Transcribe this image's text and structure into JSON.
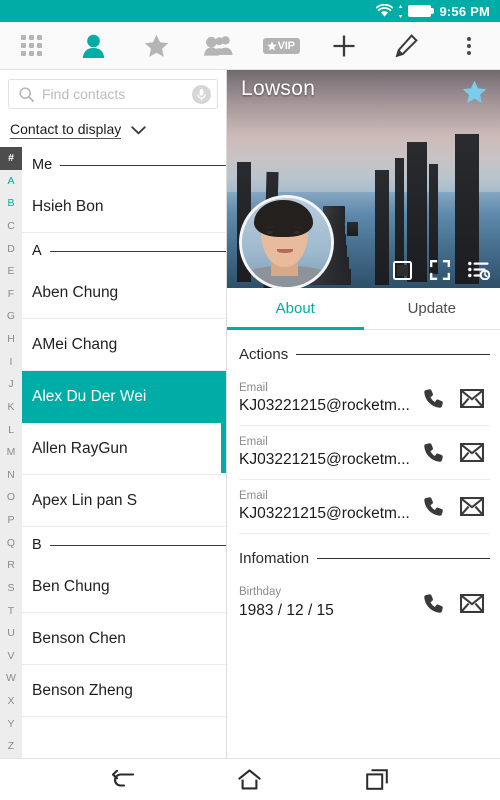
{
  "statusbar": {
    "time": "9:56 PM",
    "wifi_icon": "wifi-icon",
    "battery_icon": "battery-icon",
    "accent": "#00ACA6"
  },
  "toolbar": {
    "items": [
      {
        "name": "groups-grid",
        "icon": "grid-icon",
        "active": false
      },
      {
        "name": "contacts",
        "icon": "person-icon",
        "active": true
      },
      {
        "name": "favorites",
        "icon": "star-icon",
        "active": false
      },
      {
        "name": "groups",
        "icon": "people-group-icon",
        "active": false
      },
      {
        "name": "vip",
        "icon": "vip-badge-icon",
        "label": "VIP",
        "active": false
      },
      {
        "name": "add",
        "icon": "plus-icon",
        "active": false
      },
      {
        "name": "edit",
        "icon": "pencil-icon",
        "active": false
      },
      {
        "name": "more",
        "icon": "overflow-menu-icon",
        "active": false
      }
    ]
  },
  "search": {
    "placeholder": "Find contacts",
    "value": "",
    "search_icon": "search-icon",
    "mic_icon": "microphone-icon"
  },
  "filter": {
    "label": "Contact to display",
    "chevron": "chevron-down-icon"
  },
  "index": {
    "letters": [
      "#",
      "A",
      "B",
      "C",
      "D",
      "E",
      "F",
      "G",
      "H",
      "I",
      "J",
      "K",
      "L",
      "M",
      "N",
      "O",
      "P",
      "Q",
      "R",
      "S",
      "T",
      "U",
      "V",
      "W",
      "X",
      "Y",
      "Z"
    ],
    "current": "#",
    "highlighted": [
      "A",
      "B"
    ]
  },
  "contact_list": [
    {
      "type": "group",
      "label": "Me"
    },
    {
      "type": "contact",
      "name": "Hsieh Bon",
      "selected": false
    },
    {
      "type": "group",
      "label": "A"
    },
    {
      "type": "contact",
      "name": "Aben Chung",
      "selected": false
    },
    {
      "type": "contact",
      "name": "AMei Chang",
      "selected": false
    },
    {
      "type": "contact",
      "name": "Alex Du Der Wei",
      "selected": true
    },
    {
      "type": "contact",
      "name": "Allen RayGun",
      "selected": false
    },
    {
      "type": "contact",
      "name": "Apex Lin pan S",
      "selected": false
    },
    {
      "type": "group",
      "label": "B"
    },
    {
      "type": "contact",
      "name": "Ben Chung",
      "selected": false
    },
    {
      "type": "contact",
      "name": "Benson Chen",
      "selected": false
    },
    {
      "type": "contact",
      "name": "Benson Zheng",
      "selected": false
    }
  ],
  "detail": {
    "cover_title": "Lowson",
    "favorite_icon": "star-icon",
    "favorite_color": "#79CDEA",
    "avatar_icon": "contact-avatar",
    "cover_actions": [
      {
        "name": "change-photo",
        "icon": "photo-icon"
      },
      {
        "name": "expand-cover",
        "icon": "fullscreen-icon"
      },
      {
        "name": "history",
        "icon": "list-history-icon"
      }
    ],
    "tabs": [
      {
        "label": "About",
        "active": true
      },
      {
        "label": "Update",
        "active": false
      }
    ],
    "sections": [
      {
        "title": "Actions",
        "rows": [
          {
            "label": "Email",
            "value": "KJ03221215@rocketm...",
            "actions": [
              "phone-icon",
              "envelope-icon"
            ]
          },
          {
            "label": "Email",
            "value": "KJ03221215@rocketm...",
            "actions": [
              "phone-icon",
              "envelope-icon"
            ]
          },
          {
            "label": "Email",
            "value": "KJ03221215@rocketm...",
            "actions": [
              "phone-icon",
              "envelope-icon"
            ]
          }
        ]
      },
      {
        "title": "Infomation",
        "rows": [
          {
            "label": "Birthday",
            "value": "1983 / 12 / 15",
            "actions": [
              "phone-icon",
              "envelope-icon"
            ]
          }
        ]
      }
    ]
  },
  "navbar": [
    {
      "name": "back",
      "icon": "back-arrow-icon"
    },
    {
      "name": "home",
      "icon": "home-icon"
    },
    {
      "name": "recents",
      "icon": "recent-apps-icon"
    }
  ]
}
